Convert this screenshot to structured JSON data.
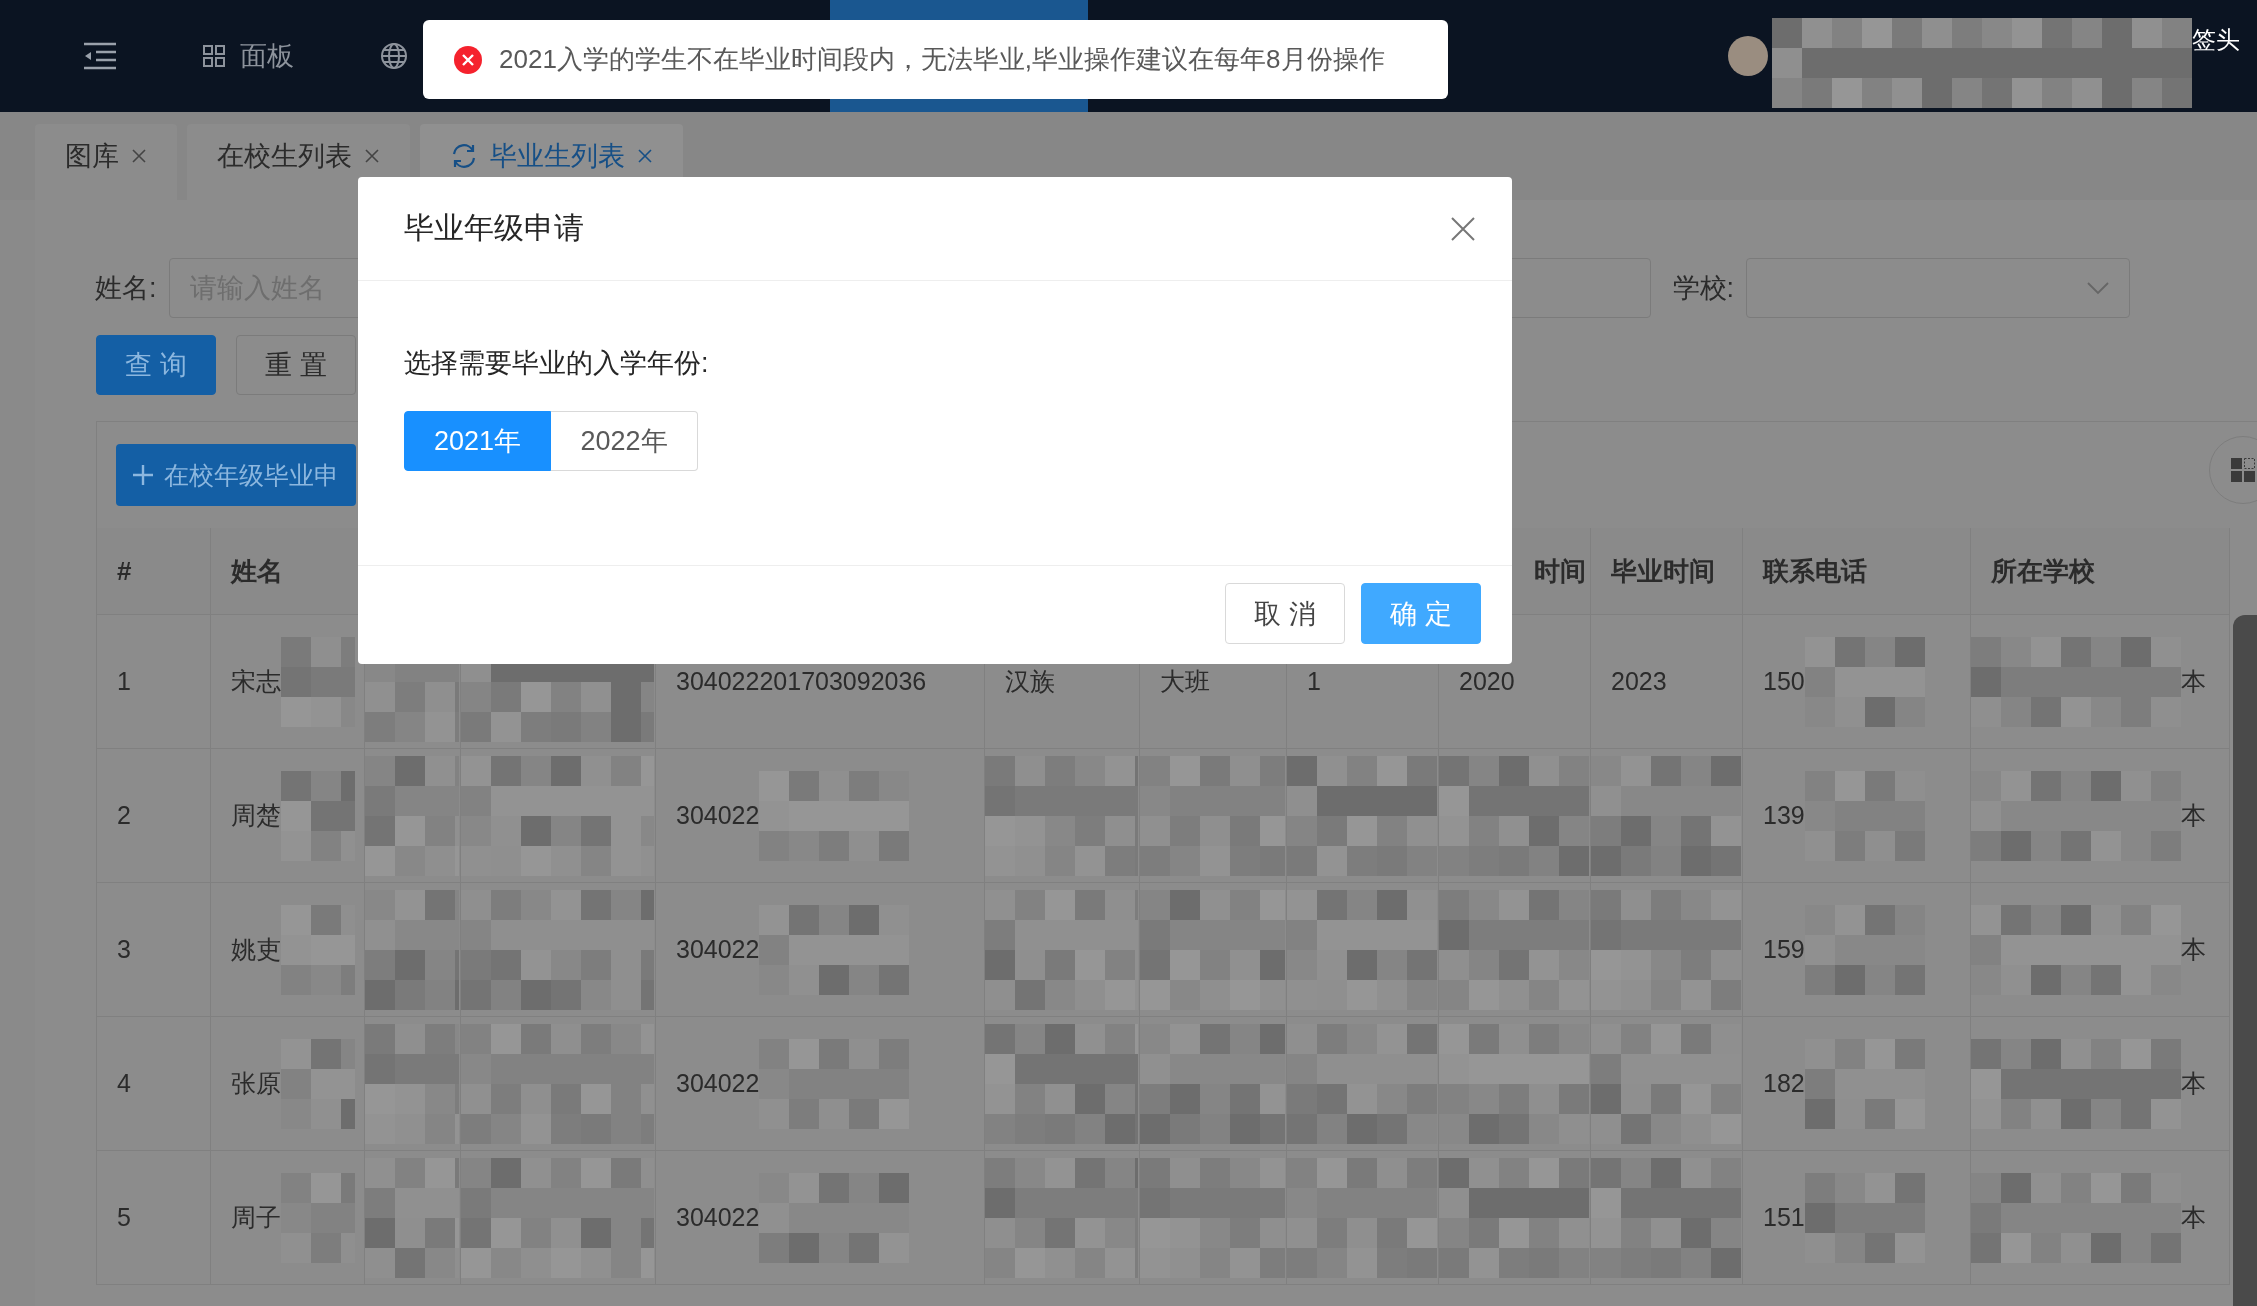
{
  "top_bar": {
    "nav_items": [
      {
        "label": "面板",
        "selected": false
      },
      {
        "selected": true
      }
    ],
    "user_label": "签头"
  },
  "toast": {
    "kind": "error",
    "message": "2021入学的学生不在毕业时间段内，无法毕业,毕业操作建议在每年8月份操作"
  },
  "tabs": [
    {
      "label": "图库",
      "selected": false
    },
    {
      "label": "在校生列表",
      "selected": false
    },
    {
      "label": "毕业生列表",
      "selected": true
    }
  ],
  "filters": [
    {
      "kind": "input",
      "label": "姓名:",
      "placeholder": "请输入姓名"
    },
    {
      "kind": "input"
    },
    {
      "kind": "select",
      "label": "学校:"
    }
  ],
  "buttons": [
    {
      "kind": "primary",
      "label": "查询"
    },
    {
      "kind": "default",
      "label": "重置"
    }
  ],
  "toolbar": {
    "add_button": "在校年级毕业申"
  },
  "table": {
    "columns": [
      {
        "label": "#"
      },
      {
        "label": "姓名"
      },
      {
        "label": "时间"
      },
      {
        "label": "毕业时间"
      },
      {
        "label": "联系电话"
      },
      {
        "label": "所在学校"
      }
    ],
    "rows": [
      {
        "number": "1",
        "name": "宋志",
        "id_number": "304022201703092036",
        "ethnicity": "汉族",
        "class": "大班",
        "column_8": "1",
        "enrolled": "2020",
        "graduated": "2023",
        "phone": "150",
        "school": "本"
      },
      {
        "number": "2",
        "name": "周楚",
        "id_number": "304022",
        "phone": "139",
        "school": "本"
      },
      {
        "number": "3",
        "name": "姚吏",
        "id_number": "304022",
        "phone": "159",
        "school": "本"
      },
      {
        "number": "4",
        "name": "张原",
        "id_number": "304022",
        "phone": "182",
        "school": "本"
      },
      {
        "number": "5",
        "name": "周子",
        "id_number": "304022",
        "phone": "151",
        "school": "本"
      }
    ]
  },
  "dialog": {
    "title": "毕业年级申请",
    "prompt": "选择需要毕业的入学年份:",
    "options": [
      {
        "label": "2021年",
        "selected": true
      },
      {
        "label": "2022年",
        "selected": false
      }
    ],
    "buttons": [
      {
        "kind": "default",
        "label": "取消"
      },
      {
        "kind": "primary",
        "label": "确定"
      }
    ]
  }
}
